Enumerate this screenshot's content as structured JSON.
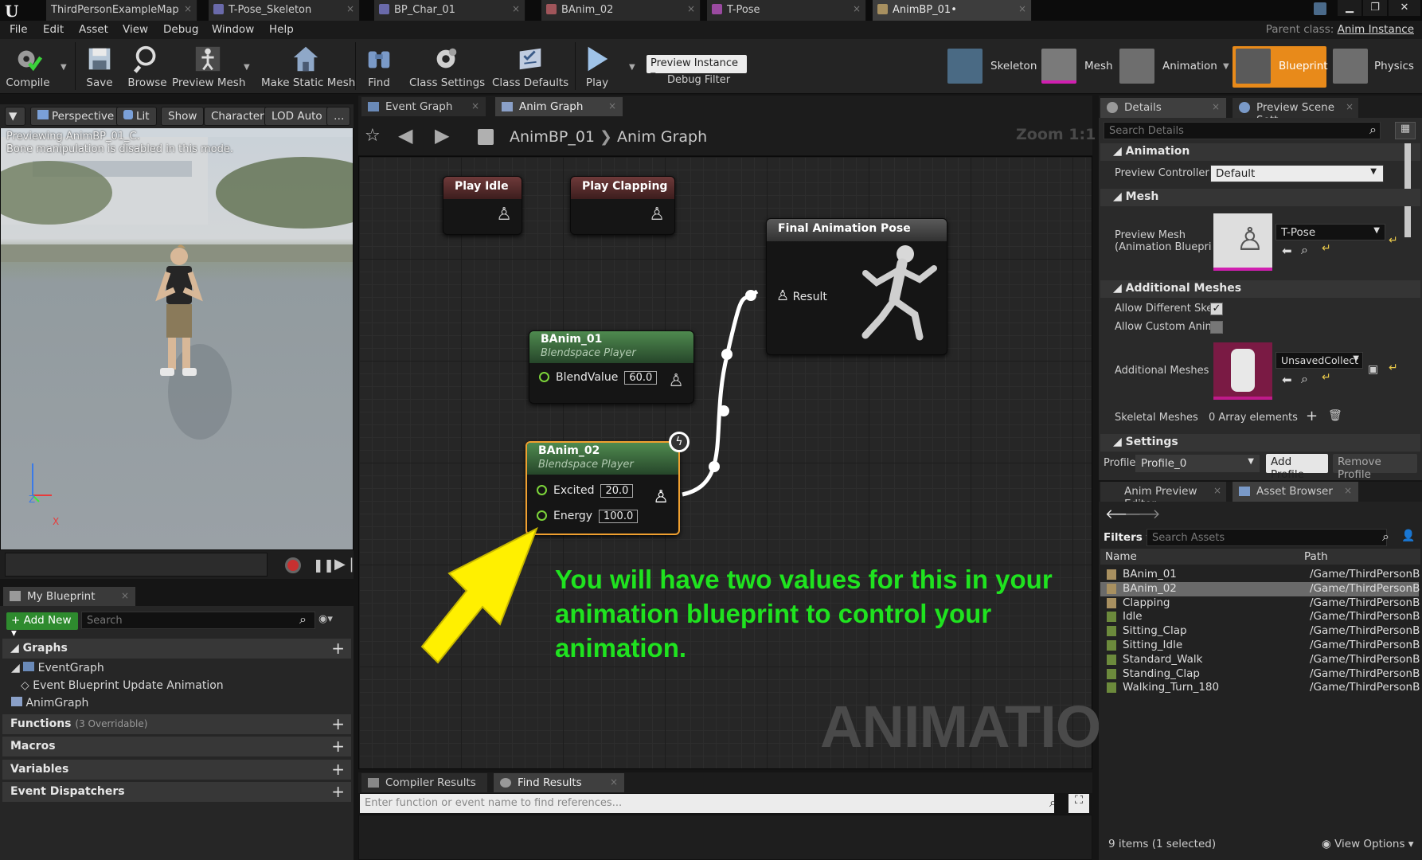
{
  "tabs": [
    {
      "label": "ThirdPersonExampleMap"
    },
    {
      "label": "T-Pose_Skeleton"
    },
    {
      "label": "BP_Char_01"
    },
    {
      "label": "BAnim_02"
    },
    {
      "label": "T-Pose"
    },
    {
      "label": "AnimBP_01•"
    }
  ],
  "menu": [
    "File",
    "Edit",
    "Asset",
    "View",
    "Debug",
    "Window",
    "Help"
  ],
  "parent_class": {
    "label": "Parent class:",
    "value": "Anim Instance"
  },
  "toolbar": {
    "buttons": [
      {
        "label": "Compile",
        "icon": "gear-check-icon"
      },
      {
        "label": "Save",
        "icon": "floppy-icon"
      },
      {
        "label": "Browse",
        "icon": "magnifier-icon"
      },
      {
        "label": "Preview Mesh",
        "icon": "mannequin-icon"
      },
      {
        "label": "Make Static Mesh",
        "icon": "house-icon"
      },
      {
        "label": "Find",
        "icon": "binoculars-icon"
      },
      {
        "label": "Class Settings",
        "icon": "gear-icon"
      },
      {
        "label": "Class Defaults",
        "icon": "checklist-icon"
      },
      {
        "label": "Play",
        "icon": "play-icon"
      }
    ],
    "preview_instance": "Preview Instance",
    "debug_filter": "Debug Filter",
    "modes": [
      "Skeleton",
      "Mesh",
      "Animation",
      "Blueprint",
      "Physics"
    ]
  },
  "viewport": {
    "buttons": [
      "Perspective",
      "Lit",
      "Show",
      "Character",
      "LOD Auto"
    ],
    "overlay_line1": "Previewing AnimBP_01_C.",
    "overlay_line2": "Bone manipulation is disabled in this mode.",
    "axis_z": "Z",
    "axis_x": "X"
  },
  "my_blueprint": {
    "tab": "My Blueprint",
    "add_new": "Add New",
    "search_placeholder": "Search",
    "sections": {
      "graphs": "Graphs",
      "functions": "Functions",
      "functions_sub": "(3 Overridable)",
      "macros": "Macros",
      "variables": "Variables",
      "dispatchers": "Event Dispatchers"
    },
    "tree": [
      "EventGraph",
      "Event Blueprint Update Animation",
      "AnimGraph"
    ]
  },
  "graph": {
    "tabs": [
      "Event Graph",
      "Anim Graph"
    ],
    "breadcrumb_root": "AnimBP_01",
    "breadcrumb_leaf": "Anim Graph",
    "zoom": "Zoom 1:1",
    "watermark": "ANIMATION",
    "nodes": {
      "play_idle": "Play Idle",
      "play_clapping": "Play Clapping",
      "final_pose": "Final Animation Pose",
      "result": "Result",
      "banim01": {
        "title": "BAnim_01",
        "subtitle": "Blendspace Player",
        "pin": "BlendValue",
        "value": "60.0"
      },
      "banim02": {
        "title": "BAnim_02",
        "subtitle": "Blendspace Player",
        "pin1": "Excited",
        "value1": "20.0",
        "pin2": "Energy",
        "value2": "100.0"
      }
    },
    "callout": "You will have two values for this in your animation blueprint to control your animation."
  },
  "results": {
    "tabs": [
      "Compiler Results",
      "Find Results"
    ],
    "placeholder": "Enter function or event name to find references..."
  },
  "details": {
    "tabs": [
      "Details",
      "Preview Scene Sett"
    ],
    "search_placeholder": "Search Details",
    "animation": "Animation",
    "preview_controller_label": "Preview Controller",
    "preview_controller_value": "Default",
    "mesh": "Mesh",
    "preview_mesh_label1": "Preview Mesh",
    "preview_mesh_label2": "(Animation Bluepri",
    "preview_mesh_value": "T-Pose",
    "additional_meshes_section": "Additional Meshes",
    "allow_different": "Allow Different Skele",
    "allow_custom": "Allow Custom Animb",
    "additional_meshes_label": "Additional Meshes",
    "additional_meshes_value": "UnsavedCollect",
    "skeletal_meshes_label": "Skeletal Meshes",
    "skeletal_meshes_value": "0 Array elements",
    "settings": "Settings",
    "profile_label": "Profile",
    "profile_value": "Profile_0",
    "add_profile": "Add Profile",
    "remove_profile": "Remove Profile"
  },
  "asset_browser": {
    "tabs": [
      "Anim Preview Editor",
      "Asset Browser"
    ],
    "filters": "Filters",
    "search_placeholder": "Search Assets",
    "col_name": "Name",
    "col_path": "Path",
    "items": [
      {
        "name": "BAnim_01",
        "path": "/Game/ThirdPersonB"
      },
      {
        "name": "BAnim_02",
        "path": "/Game/ThirdPersonB"
      },
      {
        "name": "Clapping",
        "path": "/Game/ThirdPersonB"
      },
      {
        "name": "Idle",
        "path": "/Game/ThirdPersonB"
      },
      {
        "name": "Sitting_Clap",
        "path": "/Game/ThirdPersonB"
      },
      {
        "name": "Sitting_Idle",
        "path": "/Game/ThirdPersonB"
      },
      {
        "name": "Standard_Walk",
        "path": "/Game/ThirdPersonB"
      },
      {
        "name": "Standing_Clap",
        "path": "/Game/ThirdPersonB"
      },
      {
        "name": "Walking_Turn_180",
        "path": "/Game/ThirdPersonB"
      }
    ],
    "count": "9 items (1 selected)",
    "view_options": "View Options"
  },
  "colors": {
    "accent": "#f0a030",
    "callout": "#1fe31f",
    "node_green": "#4f8a4f",
    "node_red": "#6e3a3a",
    "wire": "#ffffff"
  }
}
